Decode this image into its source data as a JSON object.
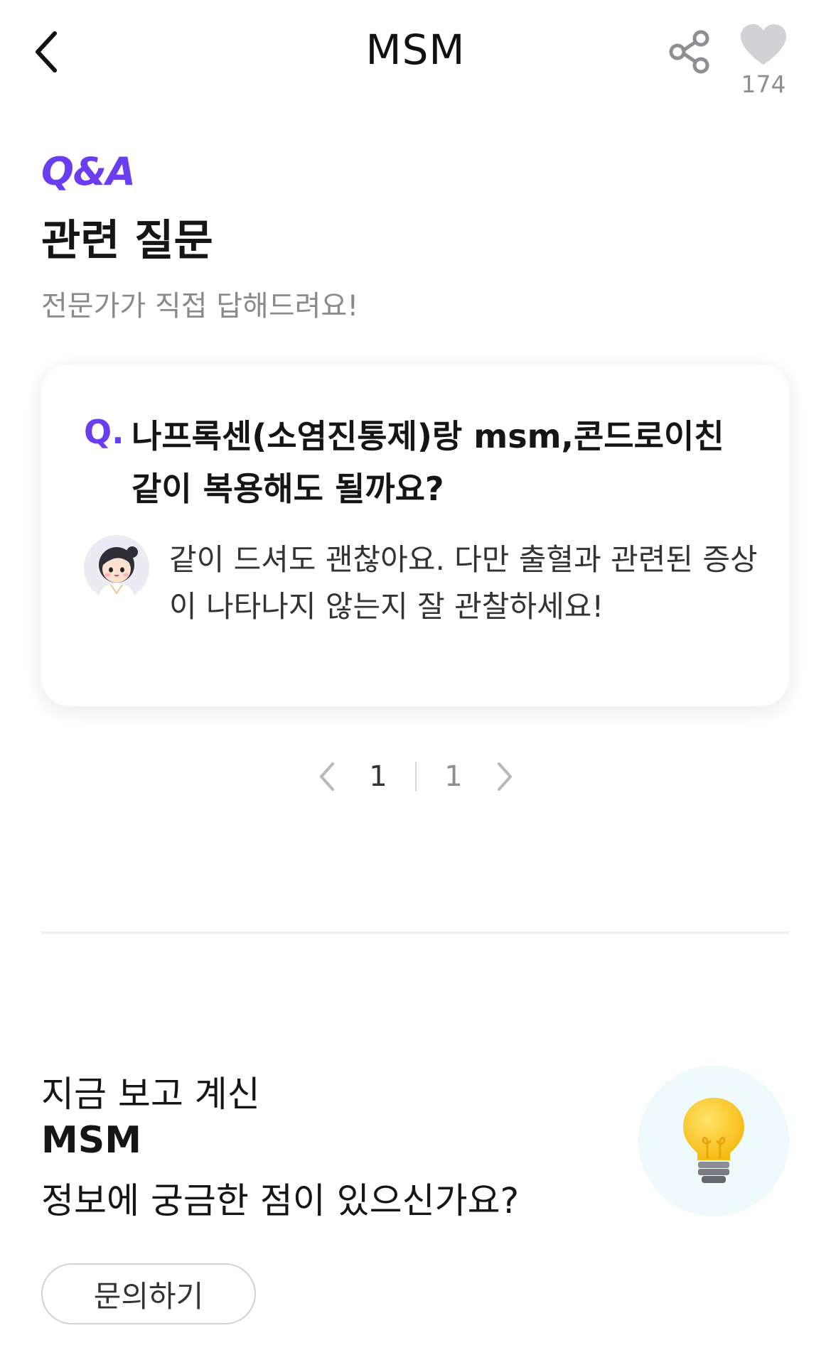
{
  "header": {
    "title": "MSM",
    "like_count": "174"
  },
  "qa_section": {
    "tag": "Q&A",
    "title": "관련 질문",
    "subtitle": "전문가가 직접 답해드려요!",
    "question": {
      "mark": "Q.",
      "text": "나프록센(소염진통제)랑 msm,콘드로이친 같이 복용해도 될까요?",
      "answer": "같이 드셔도 괜찮아요. 다만 출혈과 관련된 증상이 나타나지 않는지 잘 관찰하세요!"
    },
    "pagination": {
      "current": "1",
      "total": "1"
    }
  },
  "inquiry": {
    "line1": "지금 보고 계신",
    "line2": "MSM",
    "line3": "정보에 궁금한 점이 있으신가요?",
    "button": "문의하기"
  },
  "colors": {
    "accent": "#6b3df0",
    "bulb": "#f7c51f",
    "bulb_bg": "#eefafb"
  },
  "icons": [
    "back-chevron-icon",
    "share-icon",
    "heart-icon",
    "expert-avatar",
    "pager-prev-icon",
    "pager-next-icon",
    "lightbulb-icon"
  ]
}
